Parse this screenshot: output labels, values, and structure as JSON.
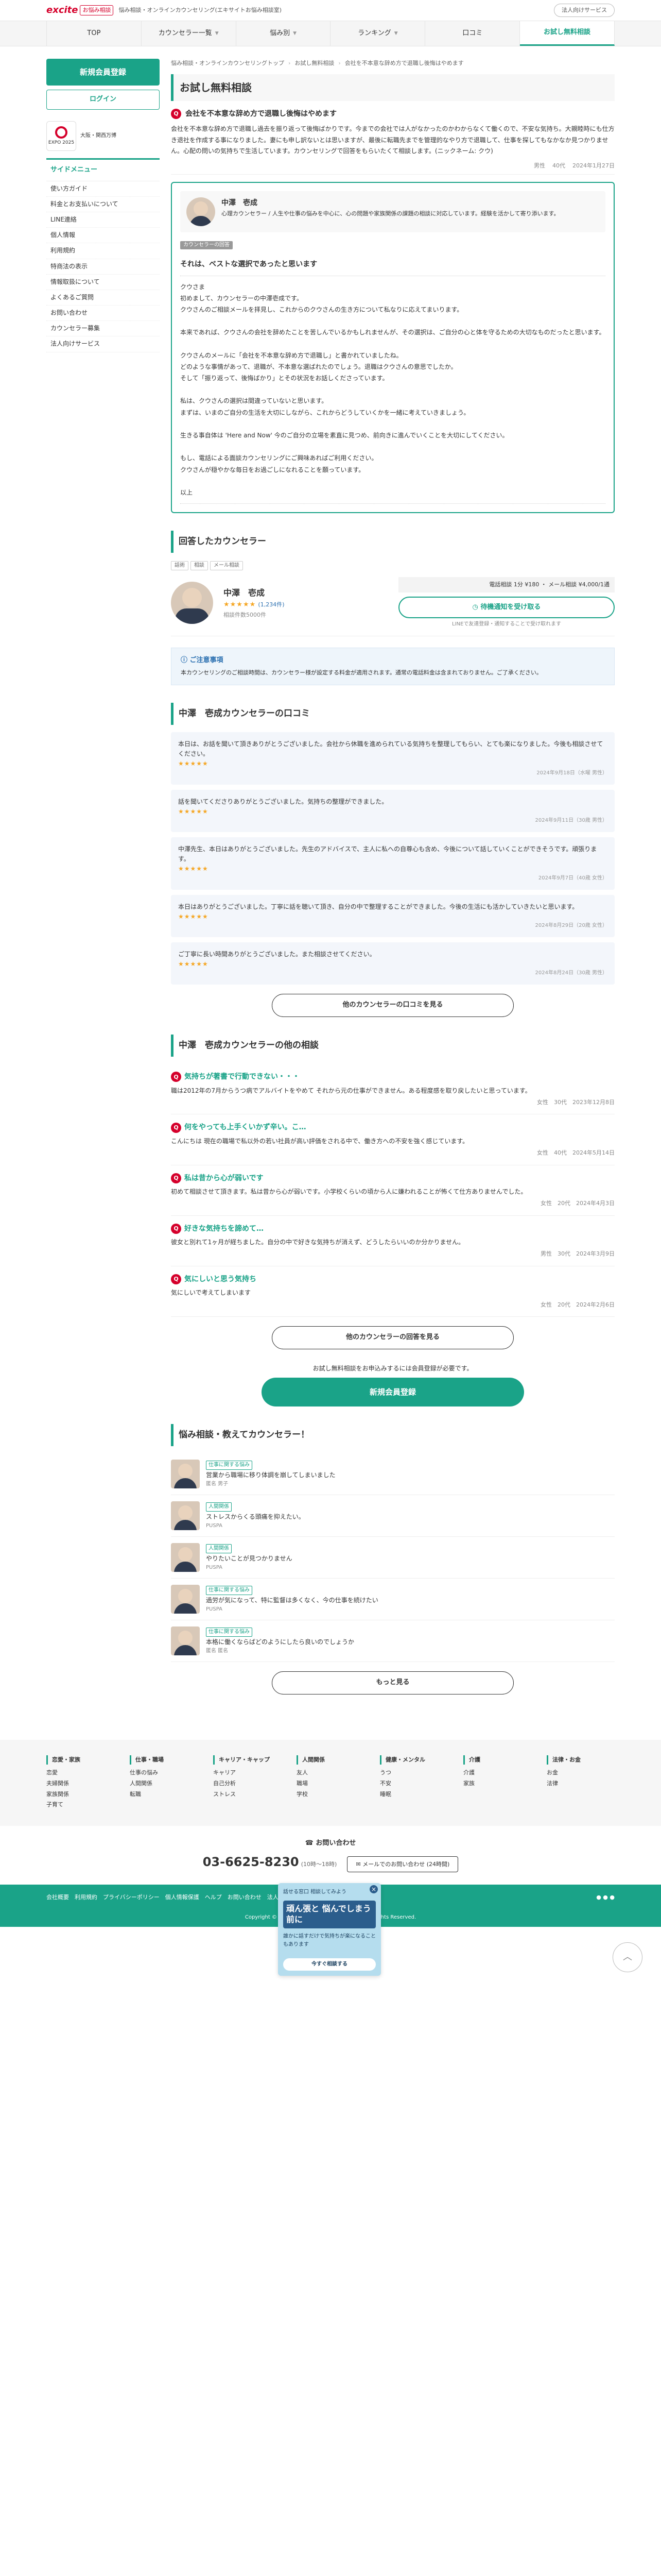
{
  "header": {
    "brand": "excite",
    "brand_sub": "お悩み相談",
    "tagline": "悩み相談・オンラインカウンセリング(エキサイトお悩み相談室)",
    "top_right": "法人向けサービス"
  },
  "nav": [
    {
      "label": "TOP"
    },
    {
      "label": "カウンセラー一覧"
    },
    {
      "label": "悩み別"
    },
    {
      "label": "ランキング"
    },
    {
      "label": "口コミ"
    },
    {
      "label": "お試し無料相談"
    }
  ],
  "side": {
    "register": "新規会員登録",
    "login": "ログイン",
    "expo": "EXPO 2025",
    "expo_text": "大阪・関西万博",
    "menu_title": "サイドメニュー",
    "menu": [
      "使い方ガイド",
      "料金とお支払いについて",
      "LINE連絡",
      "個人情報",
      "利用規約",
      "特商法の表示",
      "情報取扱について",
      "よくあるご質問",
      "お問い合わせ",
      "カウンセラー募集",
      "法人向けサービス"
    ]
  },
  "breadcrumb": [
    "悩み相談・オンラインカウンセリングトップ",
    "お試し無料相談",
    "会社を不本意な辞め方で退職し後悔はやめます"
  ],
  "page_title": "お試し無料相談",
  "question": {
    "icon": "Q",
    "title": "会社を不本意な辞め方で退職し後悔はやめます",
    "body": "会社を不本意な辞め方で退職し過去を振り返って後悔ばかりです。今までの会社では人がなかったのかわからなくて働くので、不安な気持ち。大親睦時にも仕方き退社を作成する事になりました。妻にも申し訳ないとは思いますが、最後に転職先までを管理的なやり方で退職して、仕事を探してもなかなか見つかりません。心配の問いの気持ちで生活しています。カウンセリングで回答をもらいたくて相談します。(ニックネーム: クウ)",
    "meta": [
      "男性",
      "40代",
      "2024年1月27日"
    ]
  },
  "answer": {
    "label": "カウンセラーの回答",
    "counselor_name": "中澤　壱成",
    "profile": "心理カウンセラー / 人生や仕事の悩みを中心に、心の問題や家族関係の課題の相談に対応しています。経験を活かして寄り添います。",
    "answer_title": "それは、ベストな選択であったと思います",
    "body": "クウさま\n初めまして、カウンセラーの中澤壱成です。\nクウさんのご相談メールを拝見し、これからのクウさんの生き方について私なりに応えてまいります。\n\n本来であれば、クウさんの会社を辞めたことを苦しんでいるかもしれませんが、その選択は、ご自分の心と体を守るための大切なものだったと思います。\n\nクウさんのメールに「会社を不本意な辞め方で退職し」と書かれていましたね。\nどのような事情があって、退職が、不本意な選ばれたのでしょう。退職はクウさんの意思でしたか。\nそして「振り返って、後悔ばかり」とその状況をお話しくださっています。\n\n私は、クウさんの選択は間違っていないと思います。\nまずは、いまのご自分の生活を大切にしながら、これからどうしていくかを一緒に考えていきましょう。\n\n生きる事自体は 'Here and Now' 今のご自分の立場を素直に見つめ、前向きに進んでいくことを大切にしてください。\n\nもし、電話による面談カウンセリングにご興味あればご利用ください。\nクウさんが穏やかな毎日をお過ごしになれることを願っています。\n\n以上"
  },
  "counselor": {
    "section_title": "回答したカウンセラー",
    "tags": [
      "話術",
      "相談",
      "メール相談"
    ],
    "name": "中澤　壱成",
    "rating": "(1,234件)",
    "subtitle": "相談件数5000件",
    "price_label": "電話相談 1分 ¥180 ・ メール相談 ¥4,000/1通",
    "notify_btn": "待機通知を受け取る",
    "notify_note": "LINEで友達登録・通知することで受け取れます"
  },
  "notice": {
    "title": "ご注意事項",
    "text": "本カウンセリングのご相談時間は、カウンセラー様が設定する料金が適用されます。通常の電話料金は含まれておりません。ご了承ください。"
  },
  "reviews": {
    "title": "中澤　壱成カウンセラーの口コミ",
    "items": [
      {
        "text": "本日は、お話を聞いて頂きありがとうございました。会社から休職を進められている気持ちを整理してもらい、とても楽になりました。今後も相談させてください。",
        "date": "2024年9月18日（水曜 男性）"
      },
      {
        "text": "話を聞いてくださりありがとうございました。気持ちの整理ができました。",
        "date": "2024年9月11日（30歳 男性）"
      },
      {
        "text": "中澤先生、本日はありがとうございました。先生のアドバイスで、主人に私への自尊心も含め、今後について話していくことができそうです。頑張ります。",
        "date": "2024年9月7日（40歳 女性）"
      },
      {
        "text": "本日はありがとうございました。丁寧に話を聴いて頂き、自分の中で整理することができました。今後の生活にも活かしていきたいと思います。",
        "date": "2024年8月29日（20歳 女性）"
      },
      {
        "text": "ご丁寧に長い時間ありがとうございました。また相談させてください。",
        "date": "2024年8月24日（30歳 男性）"
      }
    ],
    "more": "他のカウンセラーの口コミを見る"
  },
  "other_qs": {
    "title": "中澤　壱成カウンセラーの他の相談",
    "items": [
      {
        "title": "気持ちが著書で行動できない・・・",
        "body": "職は2012年の7月からうつ病でアルバイトをやめて それから元の仕事ができません。ある程度感を取り戻したいと思っています。",
        "meta": "女性　30代　2023年12月8日"
      },
      {
        "title": "何をやっても上手くいかず辛い。こ…",
        "body": "こんにちは 現在の職場で私以外の若い社員が高い評価をされる中で、働き方への不安を強く感じています。",
        "meta": "女性　40代　2024年5月14日"
      },
      {
        "title": "私は昔から心が弱いです",
        "body": "初めて相談させて頂きます。私は昔から心が弱いです。小学校くらいの頃から人に嫌われることが怖くて仕方ありませんでした。",
        "meta": "女性　20代　2024年4月3日"
      },
      {
        "title": "好きな気持ちを諦めて…",
        "body": "彼女と別れて1ヶ月が経ちました。自分の中で好きな気持ちが消えず、どうしたらいいのか分かりません。",
        "meta": "男性　30代　2024年3月9日"
      },
      {
        "title": "気にしいと思う気持ち",
        "body": "気にしいで考えてしまいます",
        "meta": "女性　20代　2024年2月6日"
      }
    ],
    "more": "他のカウンセラーの回答を見る"
  },
  "cta": {
    "text": "お試し無料相談をお申込みするには会員登録が必要です。",
    "button": "新規会員登録"
  },
  "recent": {
    "title": "悩み相談・教えてカウンセラー！",
    "items": [
      {
        "label": "仕事に関する悩み",
        "text": "営業から職場に移り体調を崩してしまいました",
        "user": "匿名 男子"
      },
      {
        "label": "人間関係",
        "text": "ストレスからくる頭痛を抑えたい。",
        "user": "PUSPA"
      },
      {
        "label": "人間関係",
        "text": "やりたいことが見つかりません",
        "user": "PUSPA"
      },
      {
        "label": "仕事に関する悩み",
        "text": "過労が気になって、特に監督は多くなく、今の仕事を続けたい",
        "user": "PUSPA"
      },
      {
        "label": "仕事に関する悩み",
        "text": "本格に働くならばどのようにしたら良いのでしょうか",
        "user": "匿名 匿名"
      }
    ],
    "more": "もっと見る"
  },
  "popup": {
    "top": "話せる窓口 相談してみよう",
    "title": "頑ん張と 悩んでしまう前に",
    "body": "誰かに話すだけで気持ちが楽になることもあります",
    "btn": "今すぐ相談する"
  },
  "footer": {
    "cols": [
      {
        "h": "恋愛・家族",
        "items": [
          "恋愛",
          "夫婦関係",
          "家族関係",
          "子育て"
        ]
      },
      {
        "h": "仕事・職場",
        "items": [
          "仕事の悩み",
          "人間関係",
          "転職"
        ]
      },
      {
        "h": "キャリア・キャップ",
        "items": [
          "キャリア",
          "自己分析",
          "ストレス"
        ]
      },
      {
        "h": "人間関係",
        "items": [
          "友人",
          "職場",
          "学校"
        ]
      },
      {
        "h": "健康・メンタル",
        "items": [
          "うつ",
          "不安",
          "睡眠"
        ]
      },
      {
        "h": "介護",
        "items": [
          "介護",
          "家族"
        ]
      },
      {
        "h": "法律・お金",
        "items": [
          "お金",
          "法律"
        ]
      }
    ],
    "contact_title": "お問い合わせ",
    "phone": "03-6625-8230",
    "hours": "(10時〜18時)",
    "mail_btn": "メールでのお問い合わせ (24時間)",
    "links": "会社概要　利用規約　プライバシーポリシー　個人情報保護　ヘルプ　お問い合わせ　法人向けサービス",
    "copyright": "Copyright © 1997-2024 Excite Japan Co., Ltd. All Rights Reserved."
  }
}
